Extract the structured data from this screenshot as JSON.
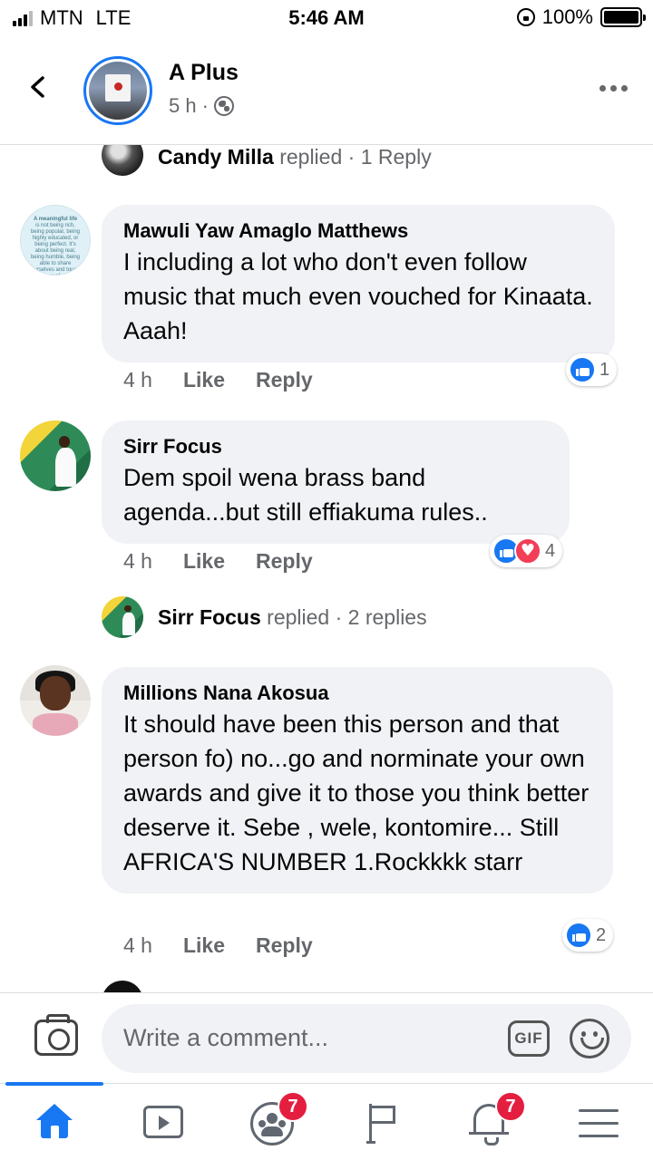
{
  "status_bar": {
    "carrier": "MTN",
    "network": "LTE",
    "time": "5:46 AM",
    "battery": "100%"
  },
  "header": {
    "page_name": "A Plus",
    "time_ago": "5 h",
    "separator": "·"
  },
  "feed": {
    "top_reply": {
      "name": "Candy Milla",
      "verb": "replied",
      "separator": "·",
      "count": "1 Reply"
    },
    "comments": [
      {
        "author": "Mawuli Yaw Amaglo Matthews",
        "text": "I including a lot who don't even follow music that much even vouched for Kinaata. Aaah!",
        "time": "4 h",
        "like_label": "Like",
        "reply_label": "Reply",
        "reactions": {
          "types": [
            "like"
          ],
          "count": "1"
        }
      },
      {
        "author": "Sirr Focus",
        "text": "Dem spoil wena brass band agenda...but still effiakuma rules..",
        "time": "4 h",
        "like_label": "Like",
        "reply_label": "Reply",
        "reactions": {
          "types": [
            "like",
            "love"
          ],
          "count": "4"
        },
        "replies": {
          "name": "Sirr Focus",
          "verb": "replied",
          "separator": "·",
          "count": "2 replies"
        }
      },
      {
        "author": "Millions Nana Akosua",
        "text": "It should have been this person and that person fo) no...go and norminate your own awards and give it to those you think better deserve it. Sebe , wele, kontomire... Still AFRICA'S NUMBER 1.Rockkkk starr",
        "time": "4 h",
        "like_label": "Like",
        "reply_label": "Reply",
        "reactions": {
          "types": [
            "like"
          ],
          "count": "2"
        }
      }
    ]
  },
  "composer": {
    "placeholder": "Write a comment...",
    "gif_label": "GIF"
  },
  "tabbar": {
    "tabs": [
      {
        "name": "home",
        "active": true
      },
      {
        "name": "watch"
      },
      {
        "name": "groups",
        "badge": "7"
      },
      {
        "name": "pages"
      },
      {
        "name": "notifications",
        "badge": "7"
      },
      {
        "name": "menu"
      }
    ]
  },
  "colors": {
    "accent": "#1877f2",
    "badge": "#e41e3f",
    "bubble": "#f0f2f5",
    "muted": "#65676b"
  }
}
